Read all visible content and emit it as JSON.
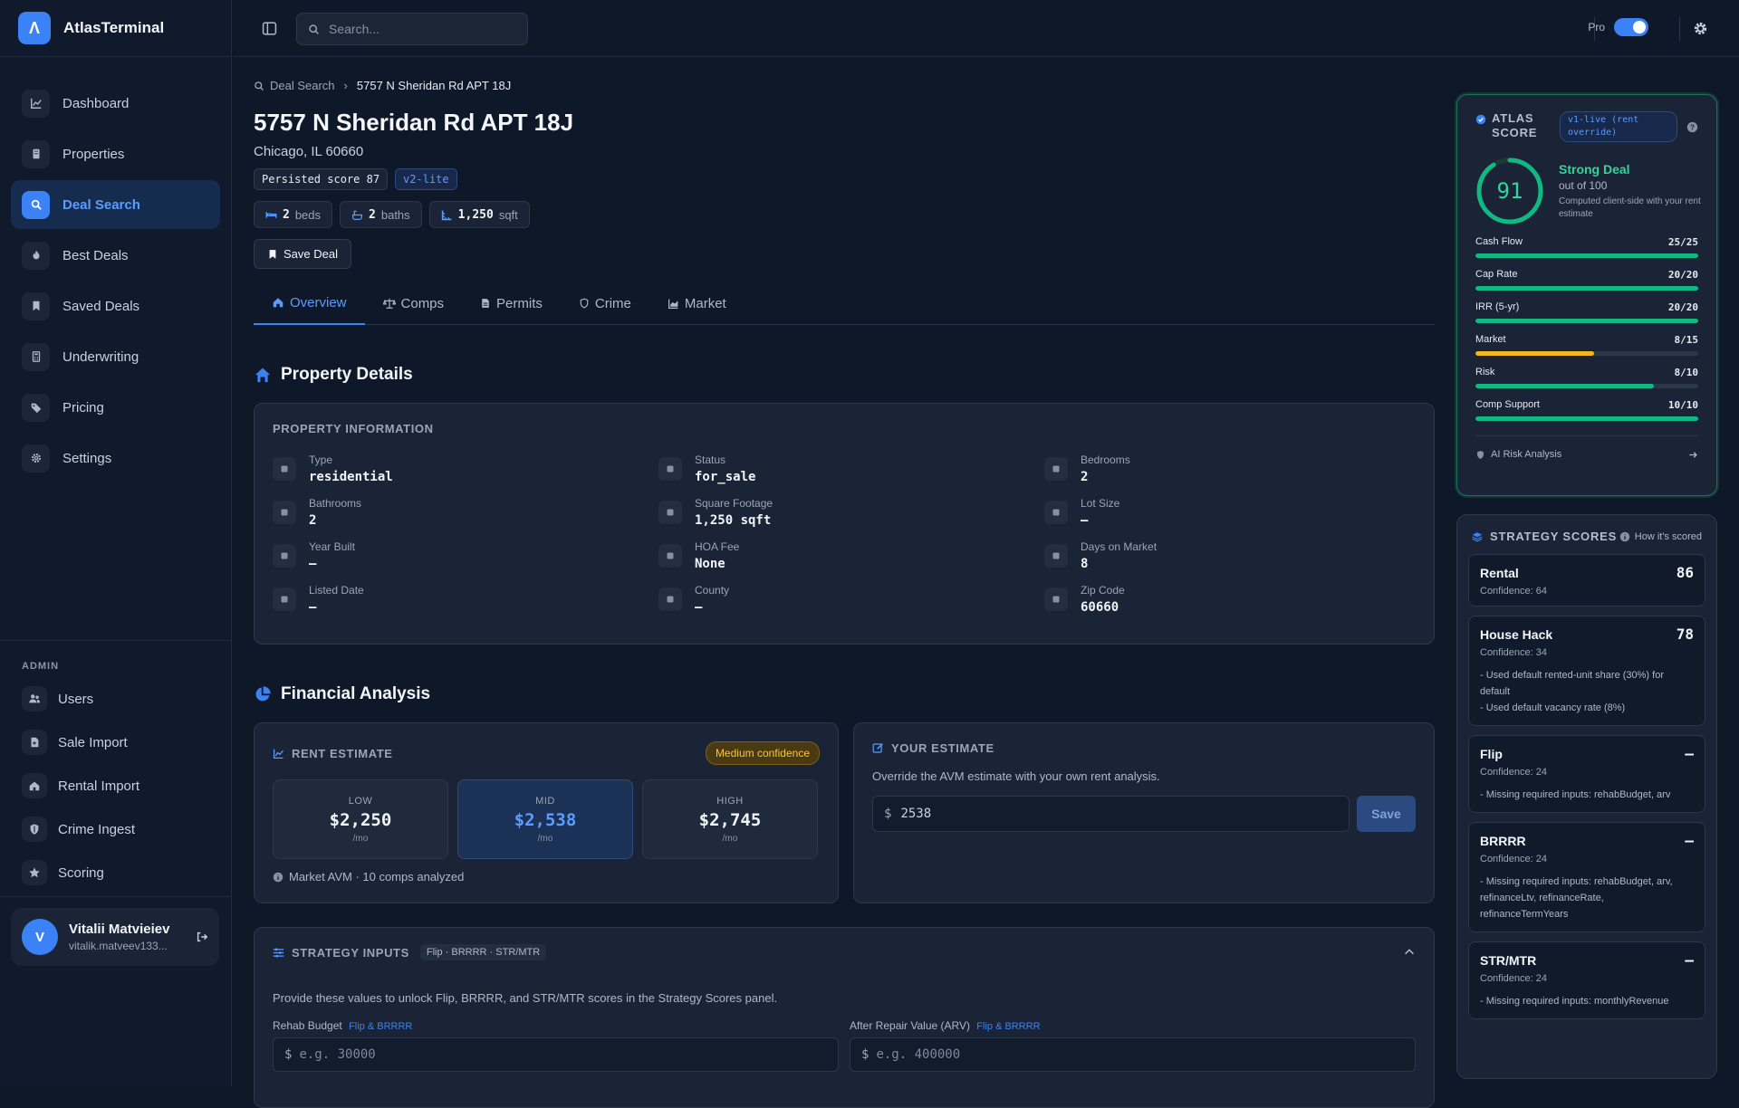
{
  "brand": {
    "name": "AtlasTerminal",
    "logo_glyph": "Λ"
  },
  "nav": [
    {
      "label": "Dashboard",
      "icon": "chart-line-icon"
    },
    {
      "label": "Properties",
      "icon": "building-icon"
    },
    {
      "label": "Deal Search",
      "icon": "search-icon",
      "active": true
    },
    {
      "label": "Best Deals",
      "icon": "flame-icon"
    },
    {
      "label": "Saved Deals",
      "icon": "bookmark-icon"
    },
    {
      "label": "Underwriting",
      "icon": "calculator-icon"
    },
    {
      "label": "Pricing",
      "icon": "tag-icon"
    },
    {
      "label": "Settings",
      "icon": "gear-icon"
    }
  ],
  "admin": {
    "title": "ADMIN",
    "items": [
      {
        "label": "Users",
        "icon": "users-icon"
      },
      {
        "label": "Sale Import",
        "icon": "file-import-icon"
      },
      {
        "label": "Rental Import",
        "icon": "house-import-icon"
      },
      {
        "label": "Crime Ingest",
        "icon": "shield-icon"
      },
      {
        "label": "Scoring",
        "icon": "star-icon"
      }
    ]
  },
  "user": {
    "initial": "V",
    "name": "Vitalii Matvieiev",
    "email": "vitalik.matveev133..."
  },
  "topbar": {
    "search_placeholder": "Search...",
    "pro_label": "Pro",
    "pro_enabled": true
  },
  "breadcrumb": {
    "root": "Deal Search",
    "current": "5757 N Sheridan Rd APT 18J"
  },
  "property": {
    "title": "5757 N Sheridan Rd APT 18J",
    "address": "Chicago, IL 60660",
    "persisted_badge": "Persisted score 87",
    "version_badge": "v2-lite",
    "beds_val": "2",
    "beds_unit": "beds",
    "baths_val": "2",
    "baths_unit": "baths",
    "sqft_val": "1,250",
    "sqft_unit": "sqft",
    "save_label": "Save Deal"
  },
  "tabs": [
    {
      "label": "Overview",
      "active": true
    },
    {
      "label": "Comps"
    },
    {
      "label": "Permits"
    },
    {
      "label": "Crime"
    },
    {
      "label": "Market"
    }
  ],
  "details": {
    "section_title": "Property Details",
    "card_title": "PROPERTY INFORMATION",
    "fields": [
      {
        "label": "Type",
        "value": "residential",
        "icon": "building-icon"
      },
      {
        "label": "Status",
        "value": "for_sale",
        "icon": "info-icon"
      },
      {
        "label": "Bedrooms",
        "value": "2",
        "icon": "bed-icon"
      },
      {
        "label": "Bathrooms",
        "value": "2",
        "icon": "bath-icon"
      },
      {
        "label": "Square Footage",
        "value": "1,250 sqft",
        "icon": "ruler-icon"
      },
      {
        "label": "Lot Size",
        "value": "—",
        "icon": "expand-icon"
      },
      {
        "label": "Year Built",
        "value": "—",
        "icon": "calendar-icon"
      },
      {
        "label": "HOA Fee",
        "value": "None",
        "icon": "receipt-icon"
      },
      {
        "label": "Days on Market",
        "value": "8",
        "icon": "clock-icon"
      },
      {
        "label": "Listed Date",
        "value": "—",
        "icon": "calendar-check-icon"
      },
      {
        "label": "County",
        "value": "—",
        "icon": "map-icon"
      },
      {
        "label": "Zip Code",
        "value": "60660",
        "icon": "pin-icon"
      }
    ]
  },
  "financial": {
    "section_title": "Financial Analysis",
    "rent": {
      "title": "RENT ESTIMATE",
      "confidence": "Medium confidence",
      "low_label": "LOW",
      "low_value": "$2,250",
      "mid_label": "MID",
      "mid_value": "$2,538",
      "high_label": "HIGH",
      "high_value": "$2,745",
      "unit": "/mo",
      "footer": "Market AVM · 10 comps analyzed"
    },
    "estimate": {
      "title": "YOUR ESTIMATE",
      "desc": "Override the AVM estimate with your own rent analysis.",
      "currency": "$",
      "value": "2538",
      "save_label": "Save"
    }
  },
  "strategy_inputs": {
    "title": "STRATEGY INPUTS",
    "tag": "Flip · BRRRR · STR/MTR",
    "desc": "Provide these values to unlock Flip, BRRRR, and STR/MTR scores in the Strategy Scores panel.",
    "rehab_label": "Rehab Budget",
    "rehab_tag": "Flip & BRRRR",
    "rehab_placeholder": "e.g. 30000",
    "arv_label": "After Repair Value (ARV)",
    "arv_tag": "Flip & BRRRR",
    "arv_placeholder": "e.g. 400000",
    "currency": "$"
  },
  "atlas_score": {
    "title_1": "ATLAS",
    "title_2": "SCORE",
    "version_1": "v1-live (rent",
    "version_2": "override)",
    "score": "91",
    "score_value": 91,
    "score_max": 100,
    "verdict": "Strong Deal",
    "out_of": "out of 100",
    "note": "Computed client-side with your rent estimate",
    "components": [
      {
        "label": "Cash Flow",
        "value": "25/25",
        "fraction": 1.0,
        "color": "#10b981"
      },
      {
        "label": "Cap Rate",
        "value": "20/20",
        "fraction": 1.0,
        "color": "#10b981"
      },
      {
        "label": "IRR (5-yr)",
        "value": "20/20",
        "fraction": 1.0,
        "color": "#10b981"
      },
      {
        "label": "Market",
        "value": "8/15",
        "fraction": 0.533,
        "color": "#f5b81c"
      },
      {
        "label": "Risk",
        "value": "8/10",
        "fraction": 0.8,
        "color": "#10b981"
      },
      {
        "label": "Comp Support",
        "value": "10/10",
        "fraction": 1.0,
        "color": "#10b981"
      }
    ],
    "ai_link": "AI Risk Analysis"
  },
  "strategy_scores": {
    "title": "STRATEGY SCORES",
    "help": "How it's scored",
    "items": [
      {
        "name": "Rental",
        "score": "86",
        "confidence": "Confidence: 64"
      },
      {
        "name": "House Hack",
        "score": "78",
        "confidence": "Confidence: 34",
        "notes": [
          "- Used default rented-unit share (30%) for default",
          "- Used default vacancy rate (8%)"
        ]
      },
      {
        "name": "Flip",
        "score": "–",
        "confidence": "Confidence: 24",
        "notes": [
          "- Missing required inputs: rehabBudget, arv"
        ]
      },
      {
        "name": "BRRRR",
        "score": "–",
        "confidence": "Confidence: 24",
        "notes": [
          "- Missing required inputs: rehabBudget, arv, refinanceLtv, refinanceRate, refinanceTermYears"
        ]
      },
      {
        "name": "STR/MTR",
        "score": "–",
        "confidence": "Confidence: 24",
        "notes": [
          "- Missing required inputs: monthlyRevenue"
        ]
      }
    ]
  },
  "colors": {
    "accent": "#3b82f6",
    "success": "#10b981",
    "warning": "#f5b81c",
    "bg": "#0f1829"
  }
}
